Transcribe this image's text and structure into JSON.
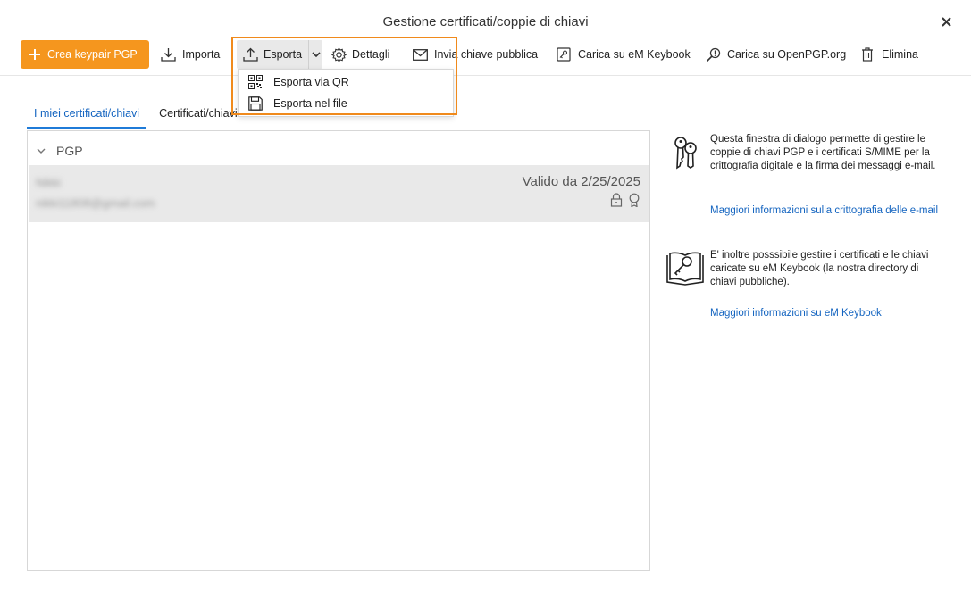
{
  "window": {
    "title": "Gestione certificati/coppie di chiavi",
    "close_icon": "close-icon"
  },
  "toolbar": {
    "create": "Crea keypair PGP",
    "import": "Importa",
    "export": "Esporta",
    "details": "Dettagli",
    "send_public_key": "Invia chiave pubblica",
    "upload_em_keybook": "Carica su eM Keybook",
    "upload_openpgp": "Carica su OpenPGP.org",
    "delete": "Elimina"
  },
  "export_menu": {
    "items": [
      {
        "label": "Esporta via QR",
        "icon": "qr-code-icon"
      },
      {
        "label": "Esporta nel file",
        "icon": "floppy-disk-icon"
      }
    ]
  },
  "tabs": [
    {
      "label": "I miei certificati/chiavi",
      "active": true
    },
    {
      "label": "Certificati/chiavi",
      "active": false
    }
  ],
  "list": {
    "group": "PGP",
    "keys": [
      {
        "name": "Nikki",
        "email": "nikki11808@gmail.com",
        "valid": "Valido da 2/25/2025"
      }
    ]
  },
  "info": {
    "text1": "Questa finestra di dialogo permette di gestire le coppie di chiavi PGP e i certificati S/MIME per la crittografia digitale e la firma dei messaggi e-mail.",
    "link1": "Maggiori informazioni sulla crittografia delle e-mail",
    "text2": "E' inoltre posssibile gestire i certificati e le chiavi caricate su eM Keybook (la nostra directory di chiavi pubbliche).",
    "link2": "Maggiori informazioni su eM Keybook"
  },
  "colors": {
    "accent": "#f5961e",
    "highlight": "#f08a1c",
    "link": "#1565c0",
    "tab_active": "#1f7bd8"
  }
}
